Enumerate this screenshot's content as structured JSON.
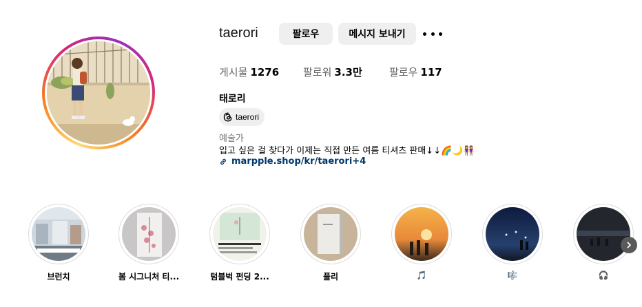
{
  "profile": {
    "username": "taerori",
    "follow_label": "팔로우",
    "message_label": "메시지 보내기",
    "stats": {
      "posts_label": "게시물",
      "posts_value": "1276",
      "followers_label": "팔로워",
      "followers_value": "3.3만",
      "following_label": "팔로우",
      "following_value": "117"
    },
    "full_name": "태로리",
    "threads_handle": "taerori",
    "category": "예술가",
    "bio": "입고 싶은 걸 찾다가 이제는 직접 만든 여름 티셔츠 판매↓↓🌈🌙👭",
    "link_text": "marpple.shop/kr/taerori+4"
  },
  "highlights": [
    {
      "label": "브런치"
    },
    {
      "label": "봄 시그니처 티..."
    },
    {
      "label": "텀블벅 펀딩 2..."
    },
    {
      "label": "플리"
    },
    {
      "label": "🎵"
    },
    {
      "label": "🎼"
    },
    {
      "label": "🎧"
    }
  ],
  "icons": {
    "more": "more-options-icon",
    "threads": "threads-icon",
    "link": "link-icon",
    "next": "chevron-right-icon"
  },
  "colors": {
    "button_bg": "#efefef",
    "link": "#00376b",
    "muted_text": "#737373",
    "story_ring_start": "#feda75",
    "story_ring_end": "#d62976"
  }
}
